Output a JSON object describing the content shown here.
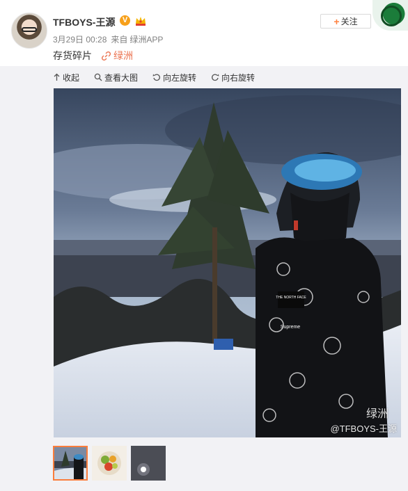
{
  "header": {
    "user_name": "TFBOYS-王源",
    "verified_badge": "V",
    "date": "3月29日 00:28",
    "source_prefix": "来自",
    "source": "绿洲APP",
    "follow_plus": "+",
    "follow_label": "关注"
  },
  "post": {
    "text": "存货碎片",
    "link_text": "绿洲",
    "link_icon": "link-icon"
  },
  "toolbar": {
    "collapse": "收起",
    "view_large": "查看大图",
    "rotate_left": "向左旋转",
    "rotate_right": "向右旋转"
  },
  "photo": {
    "watermark_app": "绿洲",
    "watermark_user": "@TFBOYS-王源",
    "sign_text": "THE NORTH FACE",
    "brand_text": "Supreme"
  },
  "thumbnails": [
    {
      "name": "snow-photo-thumb",
      "active": true
    },
    {
      "name": "fruit-photo-thumb",
      "active": false
    },
    {
      "name": "dark-photo-thumb",
      "active": false
    }
  ],
  "colors": {
    "accent": "#fa7d3c",
    "link": "#eb7350",
    "panel_bg": "#f2f2f5",
    "badge": "#f7a01a"
  }
}
